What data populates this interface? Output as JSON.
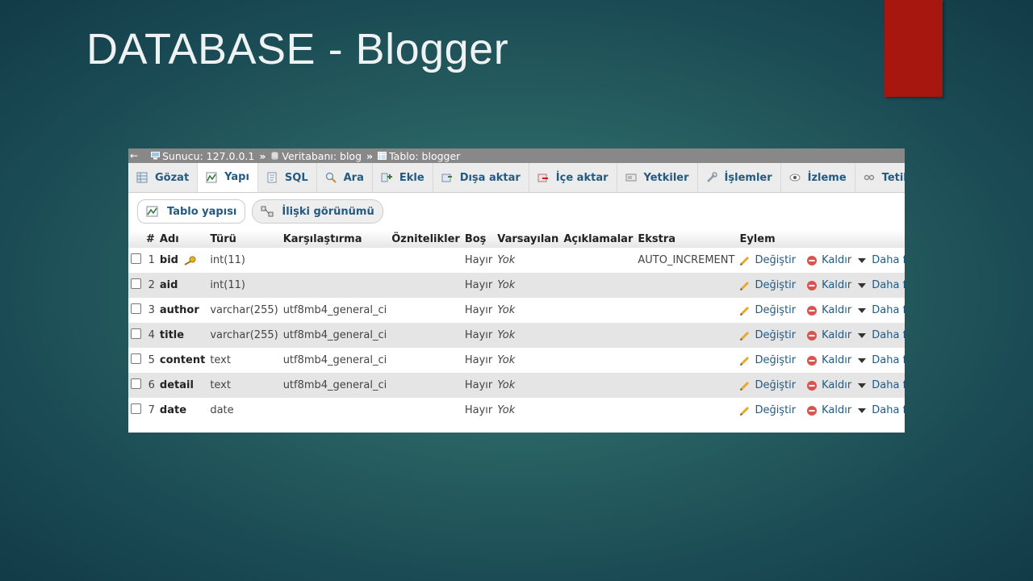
{
  "slide": {
    "title": "DATABASE - Blogger"
  },
  "breadcrumb": {
    "server": "Sunucu: 127.0.0.1",
    "separator": "»",
    "database": "Veritabanı: blog",
    "table": "Tablo: blogger"
  },
  "tabs": [
    {
      "label": "Gözat",
      "icon": "browse-icon"
    },
    {
      "label": "Yapı",
      "icon": "structure-icon"
    },
    {
      "label": "SQL",
      "icon": "sql-icon"
    },
    {
      "label": "Ara",
      "icon": "search-icon"
    },
    {
      "label": "Ekle",
      "icon": "insert-icon"
    },
    {
      "label": "Dışa aktar",
      "icon": "export-icon"
    },
    {
      "label": "İçe aktar",
      "icon": "import-icon"
    },
    {
      "label": "Yetkiler",
      "icon": "privileges-icon"
    },
    {
      "label": "İşlemler",
      "icon": "wrench-icon"
    },
    {
      "label": "İzleme",
      "icon": "eye-icon"
    },
    {
      "label": "Tetikleyi",
      "icon": "triggers-icon"
    }
  ],
  "subtabs": [
    {
      "label": "Tablo yapısı"
    },
    {
      "label": "İlişki görünümü"
    }
  ],
  "columns": [
    "#",
    "Adı",
    "Türü",
    "Karşılaştırma",
    "Öznitelikler",
    "Boş",
    "Varsayılan",
    "Açıklamalar",
    "Ekstra",
    "Eylem"
  ],
  "actions": {
    "edit": "Değiştir",
    "drop": "Kaldır",
    "more": "Daha fazla"
  },
  "rows": [
    {
      "num": "1",
      "name": "bid",
      "type": "int(11)",
      "collation": "",
      "attributes": "",
      "null": "Hayır",
      "default": "Yok",
      "comments": "",
      "extra": "AUTO_INCREMENT",
      "primary": true
    },
    {
      "num": "2",
      "name": "aid",
      "type": "int(11)",
      "collation": "",
      "attributes": "",
      "null": "Hayır",
      "default": "Yok",
      "comments": "",
      "extra": ""
    },
    {
      "num": "3",
      "name": "author",
      "type": "varchar(255)",
      "collation": "utf8mb4_general_ci",
      "attributes": "",
      "null": "Hayır",
      "default": "Yok",
      "comments": "",
      "extra": ""
    },
    {
      "num": "4",
      "name": "title",
      "type": "varchar(255)",
      "collation": "utf8mb4_general_ci",
      "attributes": "",
      "null": "Hayır",
      "default": "Yok",
      "comments": "",
      "extra": ""
    },
    {
      "num": "5",
      "name": "content",
      "type": "text",
      "collation": "utf8mb4_general_ci",
      "attributes": "",
      "null": "Hayır",
      "default": "Yok",
      "comments": "",
      "extra": ""
    },
    {
      "num": "6",
      "name": "detail",
      "type": "text",
      "collation": "utf8mb4_general_ci",
      "attributes": "",
      "null": "Hayır",
      "default": "Yok",
      "comments": "",
      "extra": ""
    },
    {
      "num": "7",
      "name": "date",
      "type": "date",
      "collation": "",
      "attributes": "",
      "null": "Hayır",
      "default": "Yok",
      "comments": "",
      "extra": ""
    }
  ],
  "colors": {
    "link": "#235a81",
    "accent_red": "#a8170f"
  }
}
